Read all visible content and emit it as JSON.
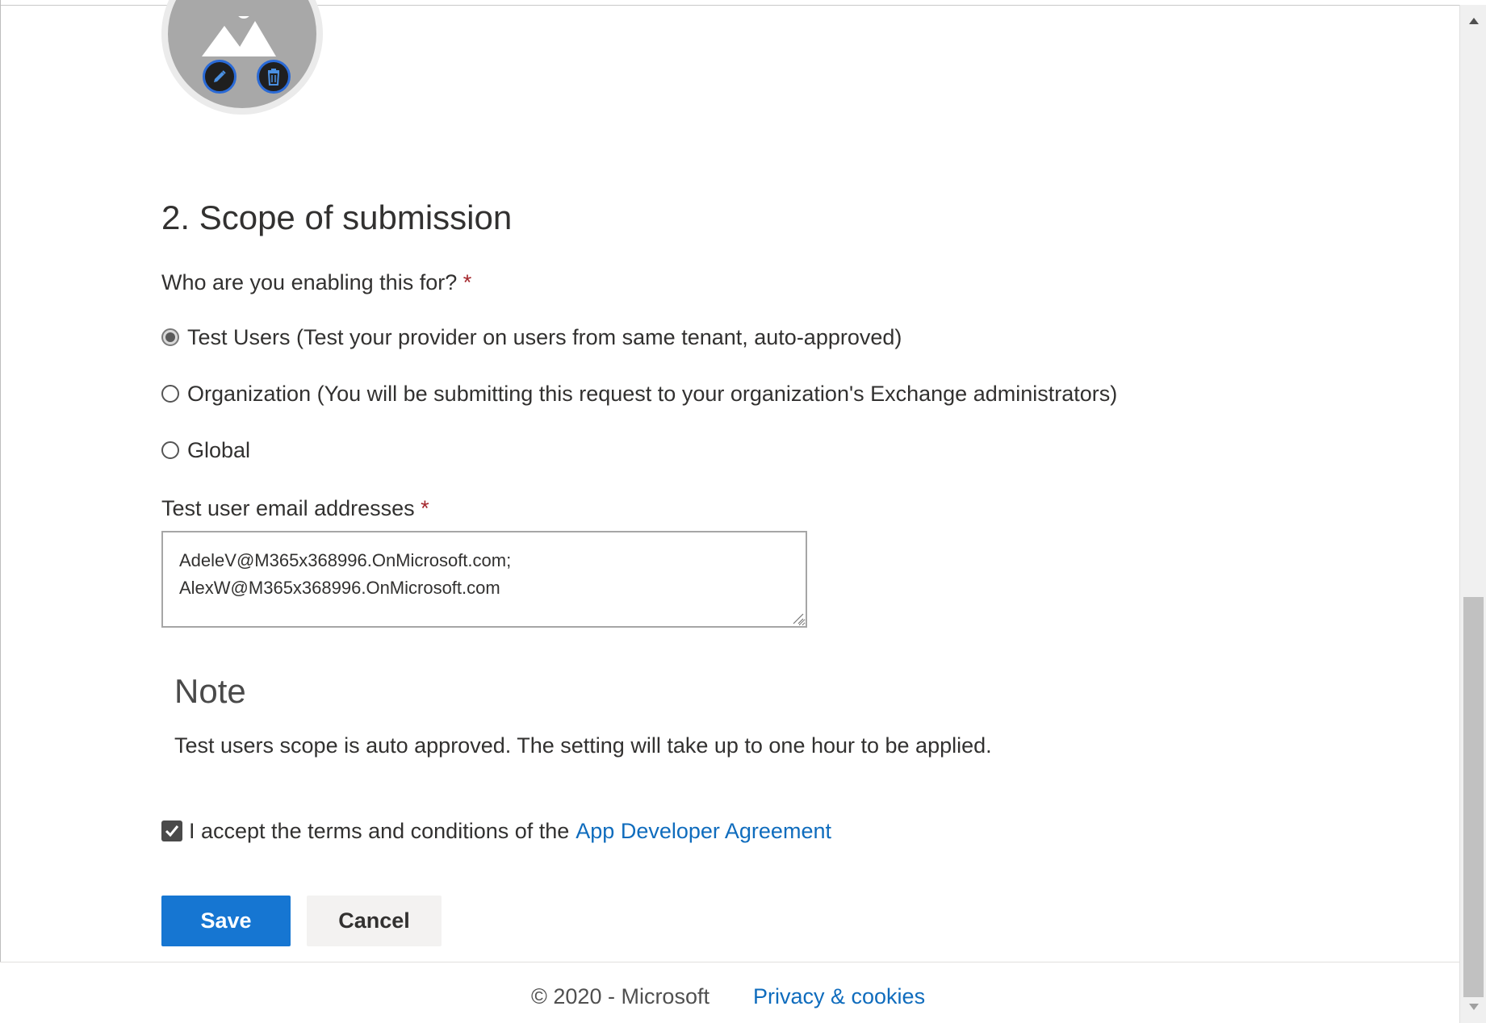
{
  "section": {
    "title": "2. Scope of submission",
    "question": "Who are you enabling this for?",
    "required_mark": "*"
  },
  "scope_options": [
    {
      "label": "Test Users (Test your provider on users from same tenant, auto-approved)",
      "checked": true
    },
    {
      "label": "Organization (You will be submitting this request to your organization's Exchange administrators)",
      "checked": false
    },
    {
      "label": "Global",
      "checked": false
    }
  ],
  "emails": {
    "label": "Test user email addresses",
    "required_mark": "*",
    "lines": [
      "AdeleV@M365x368996.OnMicrosoft.com;",
      "AlexW@M365x368996.OnMicrosoft.com"
    ]
  },
  "note": {
    "title": "Note",
    "text": "Test users scope is auto approved. The setting will take up to one hour to be applied."
  },
  "agreement": {
    "checked": true,
    "prefix": "I accept the terms and conditions of the",
    "link": "App Developer Agreement"
  },
  "buttons": {
    "save": "Save",
    "cancel": "Cancel"
  },
  "footer": {
    "copyright": "© 2020 - Microsoft",
    "privacy": "Privacy & cookies"
  },
  "colors": {
    "primary": "#1676d2",
    "link": "#0f6cbd",
    "required": "#a4262c"
  }
}
